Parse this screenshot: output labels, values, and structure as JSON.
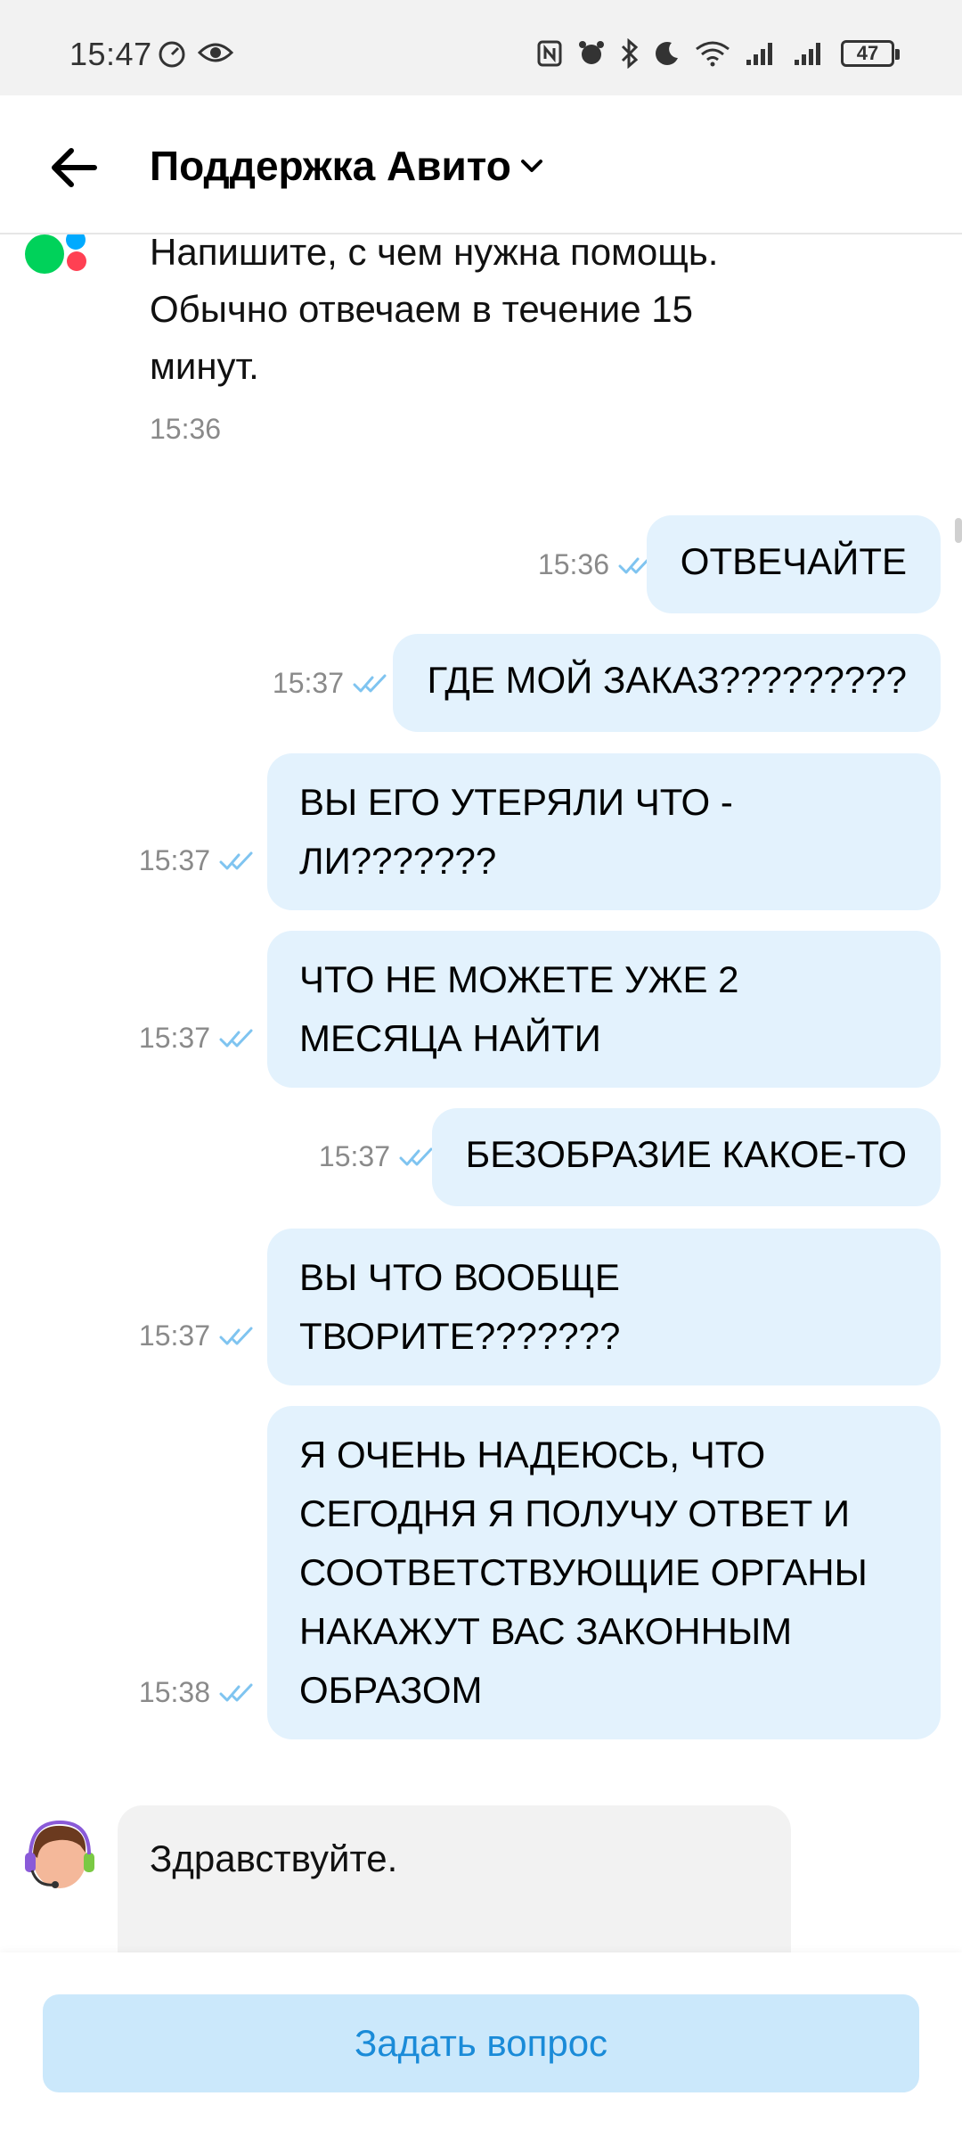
{
  "status_bar": {
    "time": "15:47",
    "battery": "47"
  },
  "header": {
    "title": "Поддержка Авито"
  },
  "system_message": {
    "text": "Напишите, с чем нужна помощь. Обычно отвечаем в течение 15 минут.",
    "time": "15:36"
  },
  "messages": [
    {
      "text": "ОТВЕЧАЙТЕ",
      "time": "15:36"
    },
    {
      "text": "ГДЕ МОЙ ЗАКАЗ?????????",
      "time": "15:37"
    },
    {
      "text": "ВЫ ЕГО УТЕРЯЛИ ЧТО - ЛИ???????",
      "time": "15:37"
    },
    {
      "text": "ЧТО НЕ МОЖЕТЕ УЖЕ 2 МЕСЯЦА НАЙТИ",
      "time": "15:37"
    },
    {
      "text": "БЕЗОБРАЗИЕ КАКОЕ-ТО",
      "time": "15:37"
    },
    {
      "text": "ВЫ ЧТО ВООБЩЕ ТВОРИТЕ???????",
      "time": "15:37"
    },
    {
      "text": "Я ОЧЕНЬ НАДЕЮСЬ, ЧТО СЕГОДНЯ Я ПОЛУЧУ ОТВЕТ И СООТВЕТСТВУЮЩИЕ ОРГАНЫ НАКАЖУТ ВАС ЗАКОННЫМ ОБРАЗОМ",
      "time": "15:38"
    }
  ],
  "agent_message": {
    "text": "Здравствуйте."
  },
  "bottom": {
    "ask_button_label": "Задать вопрос"
  },
  "colors": {
    "outgoing_bubble": "#e3f2fd",
    "incoming_bubble": "#f2f2f2",
    "accent": "#1a8bd8",
    "read_check": "#7fc4f0"
  },
  "icons": {
    "back": "arrow-left-icon",
    "chevron": "chevron-down-icon",
    "read": "double-check-icon"
  }
}
